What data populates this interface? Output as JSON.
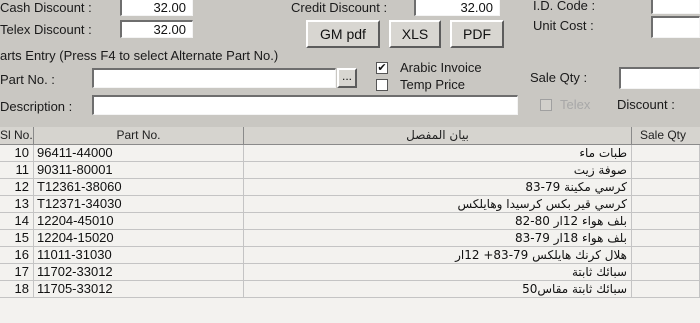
{
  "discounts": {
    "cash_label": "Cash Discount :",
    "cash_value": "32.00",
    "telex_label": "Telex Discount :",
    "telex_value": "32.00",
    "credit_label": "Credit Discount :",
    "credit_value": "32.00"
  },
  "right_panel": {
    "id_code_label": "I.D. Code :",
    "unit_cost_label": "Unit Cost :"
  },
  "toolbar": {
    "gm_pdf_label": "GM pdf",
    "xls_label": "XLS",
    "pdf_label": "PDF"
  },
  "entry": {
    "section_title": "arts Entry (Press F4 to select Alternate Part No.)",
    "part_no_label": "Part No. :",
    "part_no_value": "",
    "lookup_label": "...",
    "arabic_invoice_label": "Arabic Invoice",
    "arabic_invoice_checked": true,
    "temp_price_label": "Temp Price",
    "temp_price_checked": false,
    "sale_qty_label": "Sale Qty :",
    "description_label": "Description :",
    "telex_label": "Telex",
    "discount_label": "Discount :"
  },
  "grid": {
    "columns": [
      "Sl No.",
      "Part No.",
      "بيان المفصل",
      "Sale Qty"
    ],
    "rows": [
      {
        "sl": "10",
        "part": "96411-44000",
        "desc": "طبات ماء"
      },
      {
        "sl": "11",
        "part": "90311-80001",
        "desc": "صوفة زيت"
      },
      {
        "sl": "12",
        "part": "T12361-38060",
        "desc": "كرسي مكينة 79-83"
      },
      {
        "sl": "13",
        "part": "T12371-34030",
        "desc": "كرسي قير بكس كرسيدا وهايلكس"
      },
      {
        "sl": "14",
        "part": "12204-45010",
        "desc": "بلف هواء 12ار 80-82"
      },
      {
        "sl": "15",
        "part": "12204-15020",
        "desc": "بلف هواء 18ار 79-83"
      },
      {
        "sl": "16",
        "part": "11011-31030",
        "desc": "هلال كرنك هايلكس 79-83+ 12ار"
      },
      {
        "sl": "17",
        "part": "11702-33012",
        "desc": "سبائك ثابتة"
      },
      {
        "sl": "18",
        "part": "11705-33012",
        "desc": "سبائك ثابتة مقاس50"
      }
    ]
  }
}
